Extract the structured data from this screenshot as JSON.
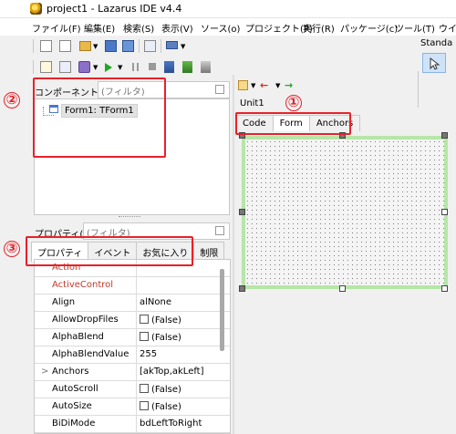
{
  "window": {
    "title": "project1  - Lazarus IDE v4.4"
  },
  "menu": [
    "ファイル(F)",
    "編集(E)",
    "検索(S)",
    "表示(V)",
    "ソース(o)",
    "プロジェクト(P)",
    "実行(R)",
    "パッケージ(c)",
    "ツール(T)",
    "ウイ"
  ],
  "palette_label": "Standa",
  "component_tree": {
    "label": "コンポーネント(m)",
    "filter_placeholder": "(フィルタ)",
    "root_item": "Form1: TForm1"
  },
  "property_section": {
    "label": "プロパティ(P)",
    "filter_placeholder": "(フィルタ)",
    "tabs": [
      "プロパティ",
      "イベント",
      "お気に入り",
      "制限"
    ]
  },
  "properties": [
    {
      "name": "Action",
      "value": "",
      "red": true
    },
    {
      "name": "ActiveControl",
      "value": "",
      "red": true
    },
    {
      "name": "Align",
      "value": "alNone"
    },
    {
      "name": "AllowDropFiles",
      "value": "(False)",
      "checkbox": true
    },
    {
      "name": "AlphaBlend",
      "value": "(False)",
      "checkbox": true
    },
    {
      "name": "AlphaBlendValue",
      "value": "255"
    },
    {
      "name": "Anchors",
      "value": "[akTop,akLeft]",
      "expand": ">"
    },
    {
      "name": "AutoScroll",
      "value": "(False)",
      "checkbox": true
    },
    {
      "name": "AutoSize",
      "value": "(False)",
      "checkbox": true
    },
    {
      "name": "BiDiMode",
      "value": "bdLeftToRight"
    }
  ],
  "editor": {
    "file_tab": "Unit1",
    "designer_tabs": [
      "Code",
      "Form",
      "Anchors"
    ]
  },
  "annotations": [
    "②",
    "①",
    "③"
  ],
  "colors": {
    "annotation": "#e8212a",
    "form_border": "#b6e6a8",
    "run": "#22a822"
  }
}
